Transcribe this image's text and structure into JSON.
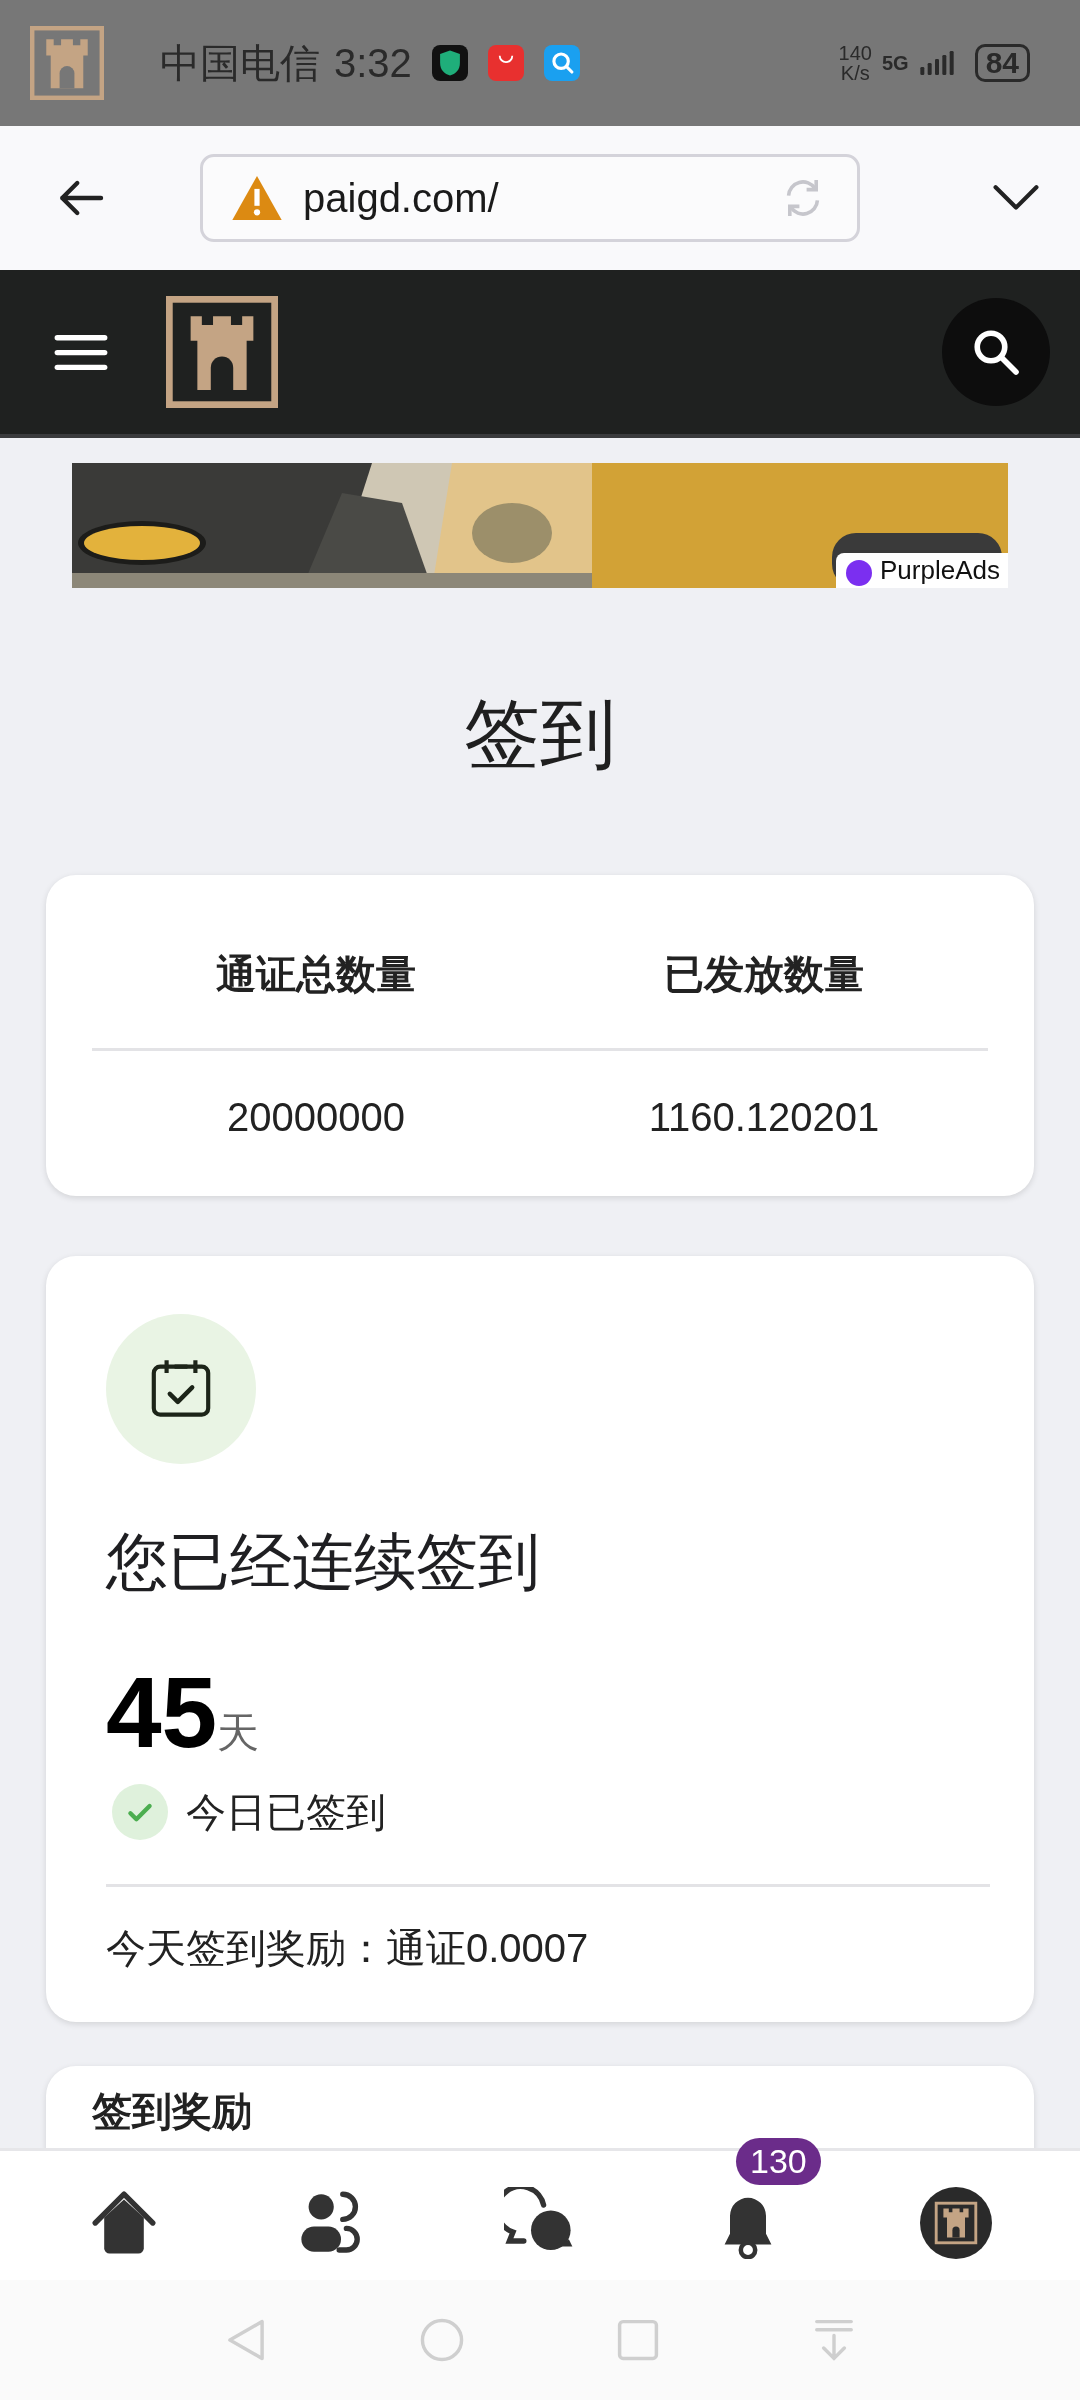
{
  "status_bar": {
    "carrier": "中国电信",
    "time": "3:32",
    "speed": "140",
    "speed_unit": "K/s",
    "network": "5G",
    "battery": "84"
  },
  "browser": {
    "url": "paigd.com/"
  },
  "ad": {
    "kind": "picture",
    "sponsor": "PurpleAds"
  },
  "page_title": "签到",
  "stats": [
    {
      "label": "通证总数量",
      "value": "20000000"
    },
    {
      "label": "已发放数量",
      "value": "1160.120201"
    }
  ],
  "streak": {
    "heading": "您已经连续签到",
    "count": "45",
    "unit": "天",
    "status": "今日已签到",
    "checked": true,
    "reward": "今天签到奖励：通证0.0007"
  },
  "next_card": {
    "title": "签到奖励"
  },
  "bottom_nav": [
    {
      "kind": "home"
    },
    {
      "kind": "friends"
    },
    {
      "kind": "chat"
    },
    {
      "kind": "bell",
      "badge": "130"
    },
    {
      "kind": "avatar"
    }
  ]
}
